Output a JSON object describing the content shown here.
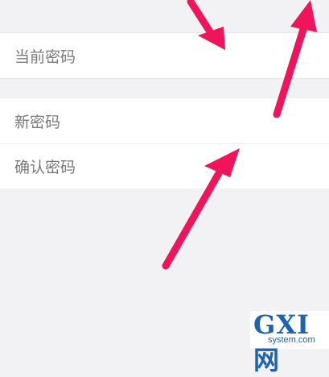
{
  "form": {
    "current_password_label": "当前密码",
    "new_password_label": "新密码",
    "confirm_password_label": "确认密码"
  },
  "watermark": {
    "brand": "GXI网",
    "domain": "system.com"
  },
  "colors": {
    "background": "#f2f2f4",
    "row": "#ffffff",
    "label": "#7a7a7a",
    "arrow": "#f0145a",
    "watermark": "#1f62b0"
  }
}
